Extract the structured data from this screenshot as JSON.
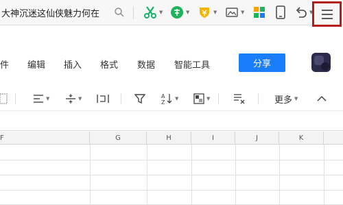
{
  "topbar": {
    "search_text": "大神沉迷这仙侠魅力何在",
    "icons": [
      "search-icon",
      "scissors-icon",
      "translate-icon",
      "coupon-icon",
      "image-icon",
      "apps-icon",
      "tablet-icon",
      "undo-icon",
      "hamburger-menu-icon"
    ]
  },
  "menubar": {
    "items": [
      "件",
      "编辑",
      "插入",
      "格式",
      "数据",
      "智能工具"
    ],
    "share_label": "分享"
  },
  "toolbar": {
    "more_label": "更多"
  },
  "grid": {
    "columns": [
      "F",
      "G",
      "H",
      "I",
      "J",
      "K"
    ]
  },
  "colors": {
    "accent": "#1a7dfa",
    "highlight_border": "#b71c1c",
    "scissors_green": "#17b26a",
    "translate_green": "#1fb35c",
    "coupon_yellow": "#f5b400"
  }
}
